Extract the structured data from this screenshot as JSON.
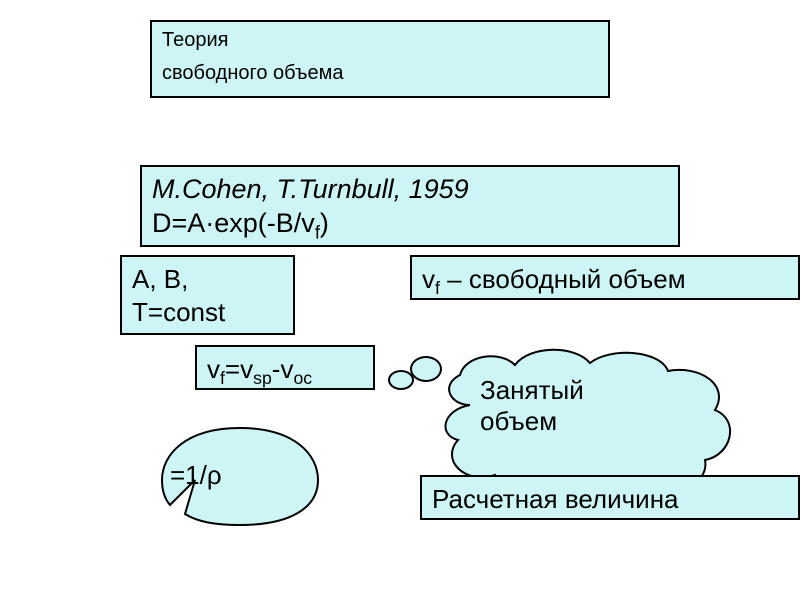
{
  "title": {
    "line1": "Теория",
    "line2": "свободного объема"
  },
  "authors": {
    "line1": "M.Cohen, T.Turnbull, 1959",
    "eq_prefix": "D=A·exp(",
    "eq_mid": "-B/v",
    "eq_sub": "f",
    "eq_suffix": ")"
  },
  "ab": {
    "line1": "A, B,",
    "line2": "T=const"
  },
  "vf": {
    "v": "v",
    "sub": "f",
    "rest": " – свободный объем"
  },
  "vfeq": {
    "p1": "v",
    "s1": "f",
    "p2": "=v",
    "s2": "sp",
    "p3": "-v",
    "s3": "oc"
  },
  "speech": {
    "text": "=1/ρ"
  },
  "cloud": {
    "line1": "Занятый",
    "line2": "объем"
  },
  "calc": {
    "text": "Расчетная величина"
  }
}
